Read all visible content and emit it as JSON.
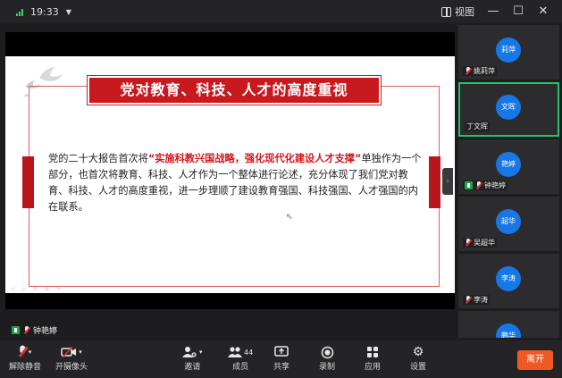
{
  "status": {
    "time": "19:33"
  },
  "window": {
    "view_label": "视图"
  },
  "slide": {
    "title": "党对教育、科技、人才的高度重视",
    "body_prefix": "党的二十大报告首次将",
    "body_highlight": "“实施科教兴国战略，强化现代化建设人才支撑”",
    "body_suffix": "单独作为一个部分，也首次将教育、科技、人才作为一个整体进行论述，充分体现了我们党对教育、科技、人才的高度重视，进一步理顺了建设教育强国、科技强国、人才强国的内在联系。"
  },
  "stage": {
    "presenter": "钟艳婷"
  },
  "participants": [
    {
      "avatar": "莉萍",
      "name": "姚莉萍"
    },
    {
      "avatar": "文晖",
      "name": "丁文晖"
    },
    {
      "avatar": "艳婷",
      "name": "钟艳婷"
    },
    {
      "avatar": "超华",
      "name": "吴超华"
    },
    {
      "avatar": "李涛",
      "name": "李涛"
    },
    {
      "avatar": "鹏华",
      "name": ""
    }
  ],
  "toolbar": {
    "unmute": "解除静音",
    "camera": "开摄像头",
    "invite": "邀请",
    "members": "成员",
    "member_count": "44",
    "share": "共享",
    "record": "录制",
    "apps": "应用",
    "settings": "设置",
    "leave": "离开"
  },
  "colors": {
    "accent_red": "#c8191e",
    "avatar_blue": "#1677e5",
    "active_green": "#21c46a",
    "leave_orange": "#ef5a24"
  }
}
